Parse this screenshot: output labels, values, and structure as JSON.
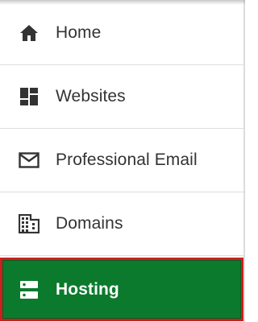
{
  "nav": {
    "items": [
      {
        "label": "Home",
        "icon": "home-icon",
        "active": false
      },
      {
        "label": "Websites",
        "icon": "dashboard-icon",
        "active": false
      },
      {
        "label": "Professional Email",
        "icon": "mail-icon",
        "active": false
      },
      {
        "label": "Domains",
        "icon": "building-icon",
        "active": false
      },
      {
        "label": "Hosting",
        "icon": "server-icon",
        "active": true
      }
    ]
  },
  "colors": {
    "active_bg": "#0b7a2d",
    "active_border": "#cc1f1f",
    "text": "#333333",
    "icon": "#333333"
  }
}
